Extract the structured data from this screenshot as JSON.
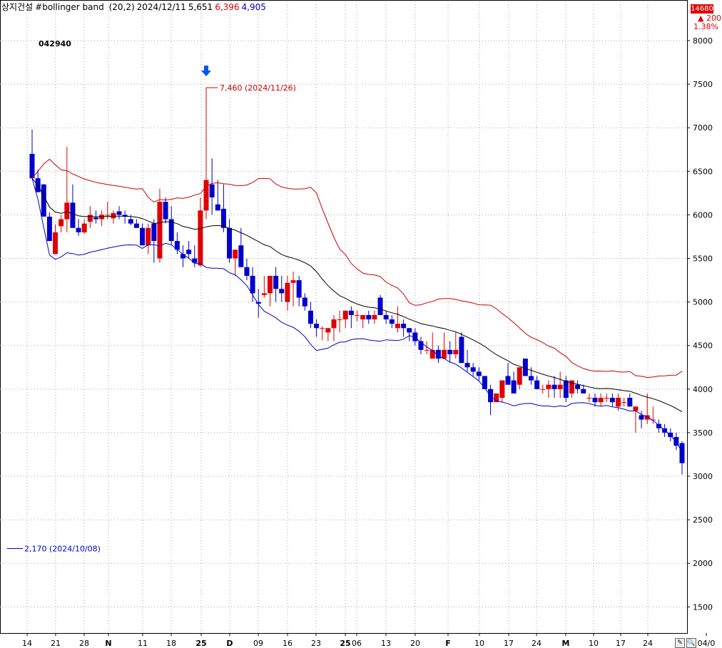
{
  "header": {
    "name": "상지건설",
    "indicator": "#bollinger band",
    "params": "(20,2)",
    "date": "2024/12/11",
    "close": "5,651",
    "upper": "6,396",
    "lower": "4,905",
    "code": "042940"
  },
  "price_panel": {
    "last": "14680",
    "change": "▲ 200",
    "pct": "1.38%"
  },
  "buttons": {
    "pen": "✎",
    "zoom": "🔍"
  },
  "colors": {
    "up": "#e00000",
    "down": "#0000cc",
    "upper_band": "#cc0000",
    "lower_band": "#0000cc",
    "mid_band": "#000000",
    "grid": "#aaaaaa"
  },
  "chart_data": {
    "type": "candlestick",
    "ylim": [
      1200,
      8450
    ],
    "yticks": [
      1500,
      2000,
      2500,
      3000,
      3500,
      4000,
      4500,
      5000,
      5500,
      6000,
      6500,
      7000,
      7500,
      8000
    ],
    "ytick_labels": [
      "1500",
      "2000",
      "2500",
      "3000",
      "3500",
      "4000",
      "4500",
      "5000",
      "5500",
      "6000",
      "6500",
      "7000",
      "7500",
      "8000"
    ],
    "xticks": [
      "14",
      "21",
      "28",
      "N",
      "11",
      "18",
      "25",
      "D",
      "09",
      "16",
      "23",
      "25",
      "06",
      "13",
      "20",
      "F",
      "10",
      "17",
      "24",
      "M",
      "10",
      "17",
      "24",
      "04/0"
    ],
    "annotations": [
      {
        "text": "7,460 (2024/11/26)",
        "value": 7460,
        "color": "#cc0000"
      },
      {
        "text": "2,170 (2024/10/08)",
        "value": 2170,
        "color": "#0000cc"
      }
    ],
    "candles": [
      [
        6700,
        6980,
        6450,
        6420
      ],
      [
        6420,
        6520,
        6280,
        6260
      ],
      [
        6350,
        6350,
        5980,
        5980
      ],
      [
        5980,
        6030,
        5700,
        5700
      ],
      [
        5550,
        5890,
        5550,
        5800
      ],
      [
        5870,
        6000,
        5800,
        5950
      ],
      [
        5950,
        6780,
        5800,
        6140
      ],
      [
        6140,
        6350,
        5880,
        5850
      ],
      [
        5850,
        5950,
        5760,
        5800
      ],
      [
        5800,
        5950,
        5780,
        5900
      ],
      [
        5920,
        6100,
        5850,
        6000
      ],
      [
        5970,
        6050,
        5900,
        5950
      ],
      [
        5950,
        6050,
        5870,
        6000
      ],
      [
        6000,
        6150,
        5950,
        6000
      ],
      [
        5960,
        6050,
        5900,
        6020
      ],
      [
        6040,
        6100,
        5950,
        6000
      ],
      [
        6000,
        6050,
        5900,
        5980
      ],
      [
        5950,
        6000,
        5880,
        5900
      ],
      [
        5900,
        5950,
        5850,
        5850
      ],
      [
        5850,
        5900,
        5750,
        5650
      ],
      [
        5650,
        5900,
        5550,
        5850
      ],
      [
        5900,
        5950,
        5450,
        5700
      ],
      [
        5500,
        6300,
        5450,
        6150
      ],
      [
        6150,
        6200,
        5900,
        5950
      ],
      [
        5950,
        6100,
        5650,
        5700
      ],
      [
        5700,
        5800,
        5550,
        5600
      ],
      [
        5550,
        5650,
        5400,
        5500
      ],
      [
        5600,
        5700,
        5500,
        5550
      ],
      [
        5500,
        5650,
        5400,
        5450
      ],
      [
        5420,
        6200,
        5400,
        6050
      ],
      [
        6050,
        7460,
        5950,
        6400
      ],
      [
        6350,
        6650,
        6000,
        6200
      ],
      [
        6120,
        6400,
        6050,
        6050
      ],
      [
        6070,
        6350,
        5800,
        5850
      ],
      [
        5850,
        5950,
        5450,
        5500
      ],
      [
        5500,
        5600,
        5300,
        5600
      ],
      [
        5650,
        5850,
        5400,
        5400
      ],
      [
        5400,
        5500,
        5250,
        5300
      ],
      [
        5300,
        5400,
        5000,
        5100
      ],
      [
        5000,
        5150,
        4820,
        4980
      ],
      [
        5080,
        5300,
        5050,
        5100
      ],
      [
        5100,
        5300,
        4950,
        5300
      ],
      [
        5300,
        5400,
        5000,
        5150
      ],
      [
        5150,
        5300,
        5000,
        5100
      ],
      [
        5000,
        5300,
        4900,
        5220
      ],
      [
        5220,
        5350,
        4950,
        5250
      ],
      [
        5250,
        5300,
        4950,
        5050
      ],
      [
        5050,
        5100,
        4900,
        4950
      ],
      [
        4900,
        5000,
        4700,
        4750
      ],
      [
        4750,
        4800,
        4600,
        4700
      ],
      [
        4700,
        4720,
        4560,
        4700
      ],
      [
        4650,
        4700,
        4550,
        4700
      ],
      [
        4700,
        4850,
        4550,
        4800
      ],
      [
        4800,
        4900,
        4650,
        4800
      ],
      [
        4800,
        4900,
        4700,
        4900
      ],
      [
        4900,
        4950,
        4700,
        4850
      ],
      [
        4850,
        4900,
        4780,
        4850
      ],
      [
        4800,
        4850,
        4700,
        4850
      ],
      [
        4850,
        4900,
        4750,
        4800
      ],
      [
        4800,
        4900,
        4750,
        4850
      ],
      [
        5050,
        5080,
        4850,
        4850
      ],
      [
        4850,
        4900,
        4750,
        4800
      ],
      [
        4800,
        4850,
        4700,
        4750
      ],
      [
        4700,
        4950,
        4650,
        4750
      ],
      [
        4750,
        4800,
        4600,
        4700
      ],
      [
        4700,
        4700,
        4550,
        4650
      ],
      [
        4650,
        4700,
        4500,
        4550
      ],
      [
        4550,
        4600,
        4400,
        4450
      ],
      [
        4450,
        4550,
        4400,
        4450
      ],
      [
        4350,
        4650,
        4350,
        4450
      ],
      [
        4450,
        4500,
        4300,
        4350
      ],
      [
        4350,
        4650,
        4350,
        4450
      ],
      [
        4450,
        4550,
        4300,
        4400
      ],
      [
        4400,
        4650,
        4350,
        4450
      ],
      [
        4600,
        4650,
        4300,
        4300
      ],
      [
        4300,
        4450,
        4200,
        4250
      ],
      [
        4250,
        4300,
        4150,
        4200
      ],
      [
        4200,
        4250,
        4100,
        4150
      ],
      [
        4150,
        4150,
        4000,
        4000
      ],
      [
        4000,
        4050,
        3700,
        3850
      ],
      [
        3850,
        3950,
        3850,
        3950
      ],
      [
        3900,
        4100,
        3850,
        4100
      ],
      [
        4150,
        4300,
        4050,
        4050
      ],
      [
        4100,
        4200,
        3950,
        3950
      ],
      [
        4050,
        4250,
        4000,
        4250
      ],
      [
        4350,
        4350,
        4150,
        4150
      ],
      [
        4150,
        4250,
        4050,
        4100
      ],
      [
        4100,
        4150,
        4000,
        4000
      ],
      [
        4000,
        4050,
        3950,
        4000
      ],
      [
        4000,
        4100,
        3900,
        4050
      ],
      [
        4050,
        4150,
        3900,
        4000
      ],
      [
        4000,
        4200,
        3900,
        4050
      ],
      [
        4100,
        4150,
        3850,
        3900
      ],
      [
        3950,
        4100,
        3900,
        4100
      ],
      [
        4050,
        4100,
        3950,
        4000
      ],
      [
        4000,
        4050,
        3950,
        3950
      ],
      [
        3900,
        3950,
        3850,
        3900
      ],
      [
        3900,
        3950,
        3800,
        3850
      ],
      [
        3850,
        3950,
        3800,
        3900
      ],
      [
        3900,
        3950,
        3850,
        3900
      ],
      [
        3900,
        3950,
        3800,
        3850
      ],
      [
        3800,
        3950,
        3750,
        3900
      ],
      [
        3850,
        3900,
        3800,
        3850
      ],
      [
        3900,
        3950,
        3800,
        3800
      ],
      [
        3750,
        3800,
        3500,
        3800
      ],
      [
        3700,
        3750,
        3550,
        3650
      ],
      [
        3650,
        3950,
        3600,
        3700
      ],
      [
        3650,
        3800,
        3600,
        3650
      ],
      [
        3600,
        3650,
        3500,
        3550
      ],
      [
        3550,
        3600,
        3450,
        3500
      ],
      [
        3500,
        3550,
        3400,
        3450
      ],
      [
        3450,
        3500,
        3300,
        3350
      ],
      [
        3380,
        3400,
        3020,
        3150
      ]
    ]
  }
}
